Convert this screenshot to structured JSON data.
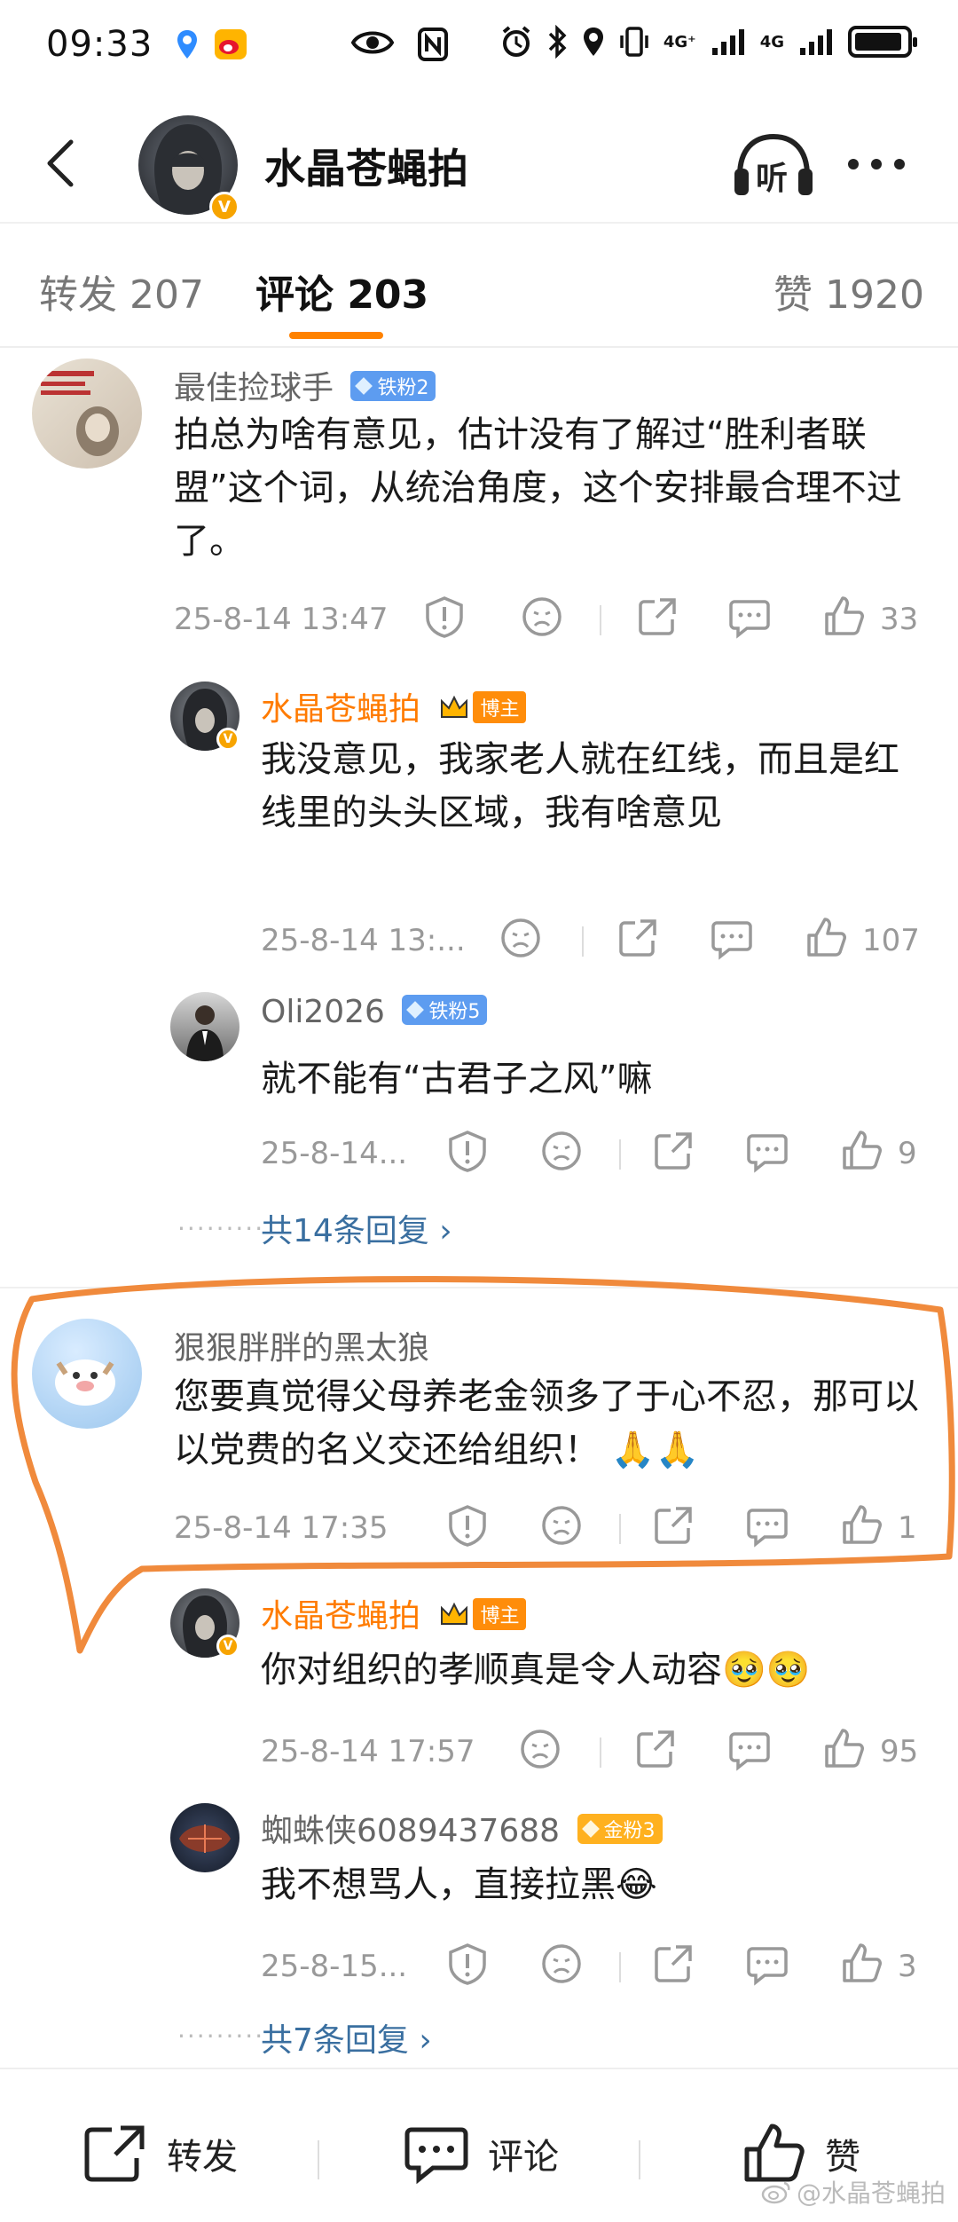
{
  "status_bar": {
    "time": "09:33",
    "network_1": "4G⁺",
    "network_2": "4G"
  },
  "header": {
    "title": "水晶苍蝇拍",
    "listen_label": "听"
  },
  "tabs": [
    {
      "label": "转发 207"
    },
    {
      "label": "评论 203"
    },
    {
      "label": "赞 1920"
    }
  ],
  "comments": [
    {
      "username": "最佳捡球手",
      "fan_badge": "铁粉2",
      "text": "拍总为啥有意见，估计没有了解过“胜利者联盟”这个词，从统治角度，这个安排最合理不过了。",
      "timestamp": "25-8-14 13:47",
      "likes": "33",
      "replies": [
        {
          "username": "水晶苍蝇拍",
          "blogger_badge": "博主",
          "text": "我没意见，我家老人就在红线，而且是红线里的头头区域，我有啥意见",
          "timestamp": "25-8-14 13:...",
          "likes": "107"
        },
        {
          "username": "Oli2026",
          "fan_badge": "铁粉5",
          "text": "就不能有“古君子之风”嘛",
          "timestamp": "25-8-14...",
          "likes": "9"
        }
      ],
      "more_replies": "共14条回复 ›"
    },
    {
      "username": "狠狠胖胖的黑太狼",
      "text": "您要真觉得父母养老金领多了于心不忍，那可以以党费的名义交还给组织！",
      "emoji": "🙏🙏",
      "timestamp": "25-8-14 17:35",
      "likes": "1",
      "replies": [
        {
          "username": "水晶苍蝇拍",
          "blogger_badge": "博主",
          "text": "你对组织的孝顺真是令人动容",
          "emoji": "🥹🥹",
          "timestamp": "25-8-14 17:57",
          "likes": "95"
        },
        {
          "username": "蜘蛛侠6089437688",
          "fan_badge": "金粉3",
          "text": "我不想骂人，直接拉黑",
          "emoji": "😂",
          "timestamp": "25-8-15...",
          "likes": "3"
        }
      ],
      "more_replies": "共7条回复 ›"
    }
  ],
  "bottom_bar": {
    "repost": "转发",
    "comment": "评论",
    "like": "赞"
  },
  "watermark": "@水晶苍蝇拍",
  "colors": {
    "accent": "#ff8200",
    "highlight_stroke": "#f08a3c",
    "link": "#3a6fa0",
    "blogger_name": "#ff7b00"
  }
}
